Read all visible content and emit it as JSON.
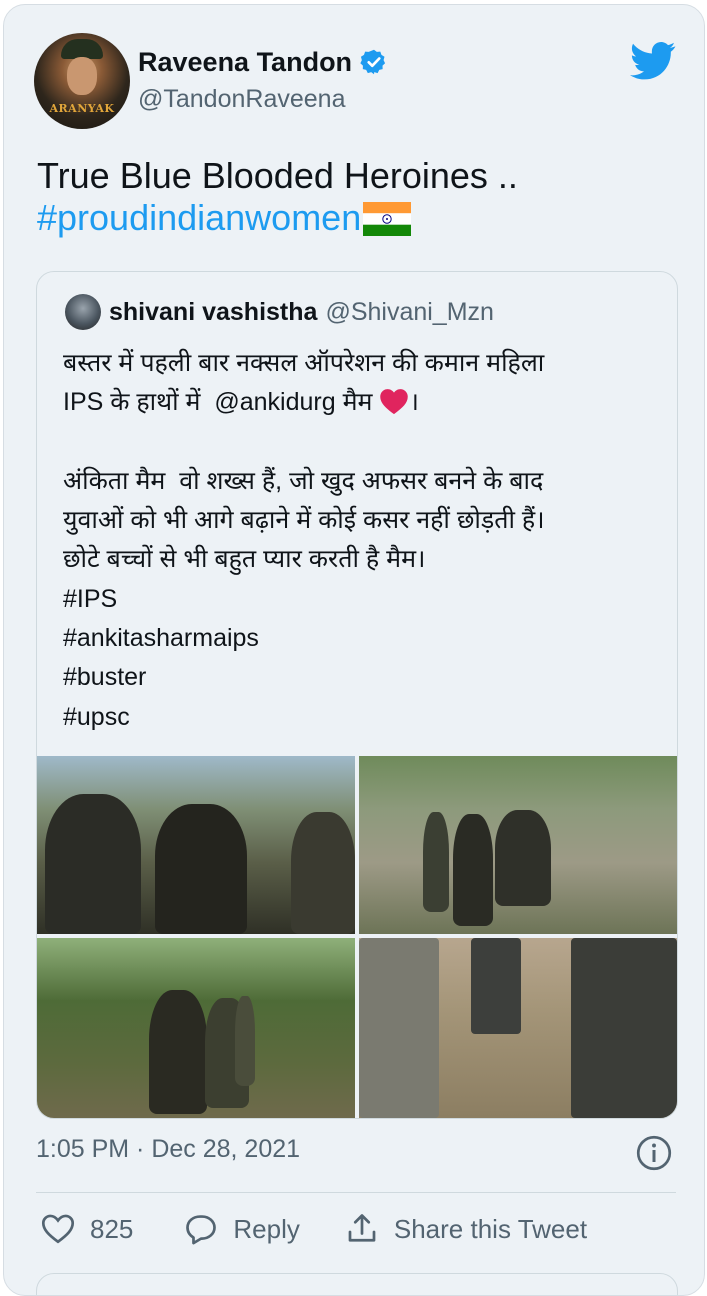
{
  "author": {
    "name": "Raveena Tandon",
    "handle": "@TandonRaveena",
    "avatar_text": "ARANYAK"
  },
  "tweet": {
    "text": "True Blue Blooded Heroines ..",
    "hashtag": "#proudindianwomen"
  },
  "quoted": {
    "name": "shivani vashistha",
    "handle": "@Shivani_Mzn",
    "line1": "बस्तर में पहली बार नक्सल ऑपरेशन की कमान महिला",
    "line2_pre": "IPS के हाथों में  @ankidurg मैम ",
    "line2_post": "।",
    "line3": "अंकिता मैम  वो शख्स हैं, जो खुद अफसर बनने के बाद",
    "line4": "युवाओं को भी आगे बढ़ाने में कोई कसर नहीं छोड़ती हैं।",
    "line5": "छोटे बच्चों से भी बहुत प्यार करती है मैम।",
    "tags": [
      "#IPS",
      "#ankitasharmaips",
      "#buster",
      "#upsc"
    ]
  },
  "meta": {
    "timestamp": "1:05 PM · Dec 28, 2021"
  },
  "actions": {
    "like_count": "825",
    "reply_label": "Reply",
    "share_label": "Share this Tweet"
  },
  "colors": {
    "accent": "#1d9bf0",
    "card_bg": "#edf2f6",
    "heart": "#e0245e"
  }
}
